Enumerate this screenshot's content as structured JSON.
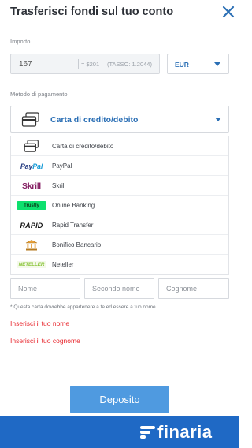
{
  "header": {
    "title": "Trasferisci fondi sul tuo conto",
    "close_icon": "close-icon"
  },
  "amount": {
    "label": "Importo",
    "value": "167",
    "usd_equivalent": "= $201",
    "rate": "(TASSO: 1.2044)"
  },
  "currency": {
    "selected": "EUR"
  },
  "payment_method": {
    "label": "Metodo di pagamento",
    "selected": "Carta di credito/debito",
    "options": [
      {
        "label": "Carta di credito/debito",
        "icon": "credit-card-icon"
      },
      {
        "label": "PayPal",
        "icon": "paypal-logo",
        "logo_text_a": "Pay",
        "logo_text_b": "Pal"
      },
      {
        "label": "Skrill",
        "icon": "skrill-logo",
        "logo_text": "Skrill"
      },
      {
        "label": "Online Banking",
        "icon": "trustly-logo",
        "logo_text": "Trustly"
      },
      {
        "label": "Rapid Transfer",
        "icon": "rapid-logo",
        "logo_text": "RAPID"
      },
      {
        "label": "Bonifico Bancario",
        "icon": "bank-icon"
      },
      {
        "label": "Neteller",
        "icon": "neteller-logo",
        "logo_text": "NETELLER"
      }
    ]
  },
  "name_fields": {
    "first_name_placeholder": "Nome",
    "middle_name_placeholder": "Secondo nome",
    "last_name_placeholder": "Cognome"
  },
  "note": "* Questa carta dovrebbe appartenere a te ed essere a tuo nome.",
  "errors": {
    "first_name": "Inserisci il tuo nome",
    "last_name": "Inserisci il tuo cognome"
  },
  "deposit_button": "Deposito",
  "footer": {
    "brand": "finaria"
  },
  "colors": {
    "accent": "#2b6fb5",
    "button": "#4f9ae0",
    "footer": "#1f69c5",
    "error": "#e8262d"
  }
}
